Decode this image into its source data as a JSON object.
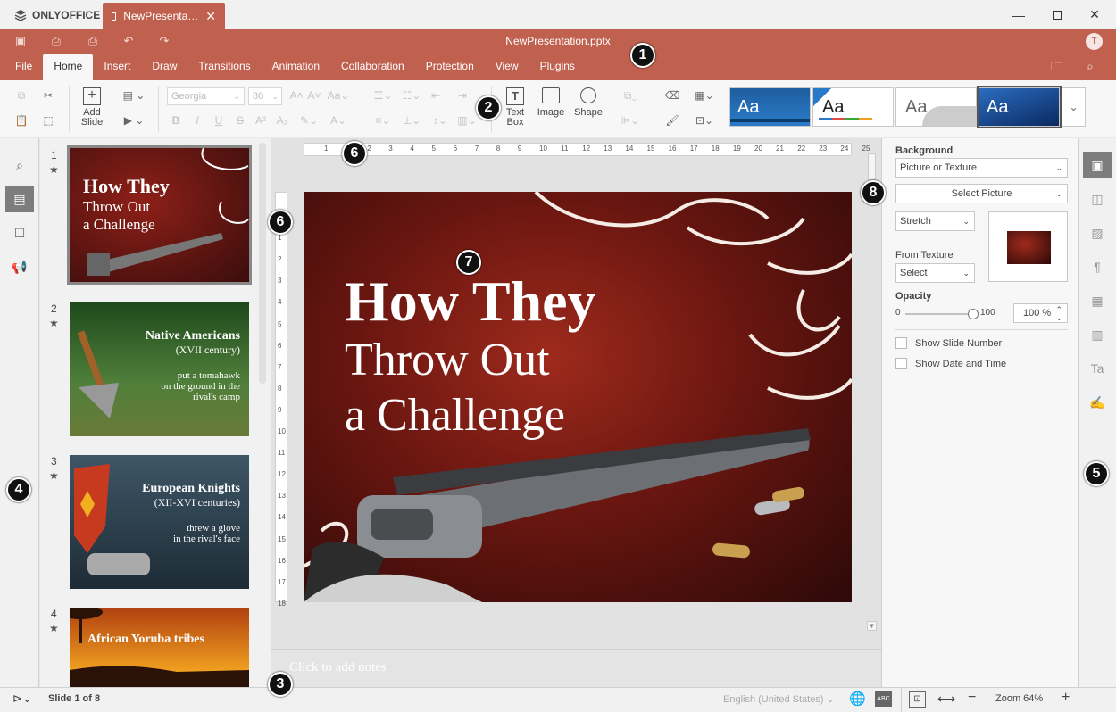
{
  "titlebar": {
    "app_name": "ONLYOFFICE",
    "doc_tab": "NewPresenta…"
  },
  "header": {
    "doc_title": "NewPresentation.pptx",
    "avatar_initial": "T",
    "tabs": [
      "File",
      "Home",
      "Insert",
      "Draw",
      "Transitions",
      "Animation",
      "Collaboration",
      "Protection",
      "View",
      "Plugins"
    ],
    "active_tab": "Home"
  },
  "toolbar": {
    "font_name": "Georgia",
    "font_size": "80",
    "add_slide": [
      "Add",
      "Slide"
    ],
    "text_box": [
      "Text",
      "Box"
    ],
    "image": "Image",
    "shape": "Shape",
    "theme_label": "Aa"
  },
  "slides": [
    {
      "num": "1",
      "title": "How They",
      "line2": "Throw Out",
      "line3": "a Challenge"
    },
    {
      "num": "2",
      "title": "Native Americans",
      "sub": "(XVII century)",
      "body1": "put a tomahawk",
      "body2": "on the ground in the",
      "body3": "rival's camp"
    },
    {
      "num": "3",
      "title": "European Knights",
      "sub": "(XII-XVI centuries)",
      "body1": "threw a glove",
      "body2": "in the rival's face"
    },
    {
      "num": "4",
      "title": "African Yoruba tribes"
    }
  ],
  "ruler": {
    "h_ticks": [
      "1",
      "1",
      "2",
      "3",
      "4",
      "5",
      "6",
      "7",
      "8",
      "9",
      "10",
      "11",
      "12",
      "13",
      "14",
      "15",
      "16",
      "17",
      "18",
      "19",
      "20",
      "21",
      "22",
      "23",
      "24",
      "25"
    ],
    "v_ticks": [
      "1",
      "1",
      "2",
      "3",
      "4",
      "5",
      "6",
      "7",
      "8",
      "9",
      "10",
      "11",
      "12",
      "13",
      "14",
      "15",
      "16",
      "17",
      "18"
    ]
  },
  "main_slide": {
    "title": "How They",
    "line2": "Throw Out",
    "line3": "a Challenge"
  },
  "notes_placeholder": "Click to add notes",
  "right_panel": {
    "background_label": "Background",
    "fill_type": "Picture or Texture",
    "select_picture": "Select Picture",
    "stretch": "Stretch",
    "from_texture_label": "From Texture",
    "texture_select": "Select",
    "opacity_label": "Opacity",
    "opacity_min": "0",
    "opacity_max": "100",
    "opacity_value": "100 %",
    "opacity_level": 1.0,
    "show_slide_number": "Show Slide Number",
    "show_date_time": "Show Date and Time"
  },
  "status": {
    "slide_counter": "Slide 1 of 8",
    "language": "English (United States)",
    "zoom": "Zoom 64%"
  },
  "callouts": [
    "1",
    "2",
    "3",
    "4",
    "5",
    "6",
    "6",
    "7",
    "8"
  ],
  "colors": {
    "accent": "#c0604f",
    "slide_bg_dark": "#3a0d0c",
    "slide_bg_red": "#8e2018"
  }
}
